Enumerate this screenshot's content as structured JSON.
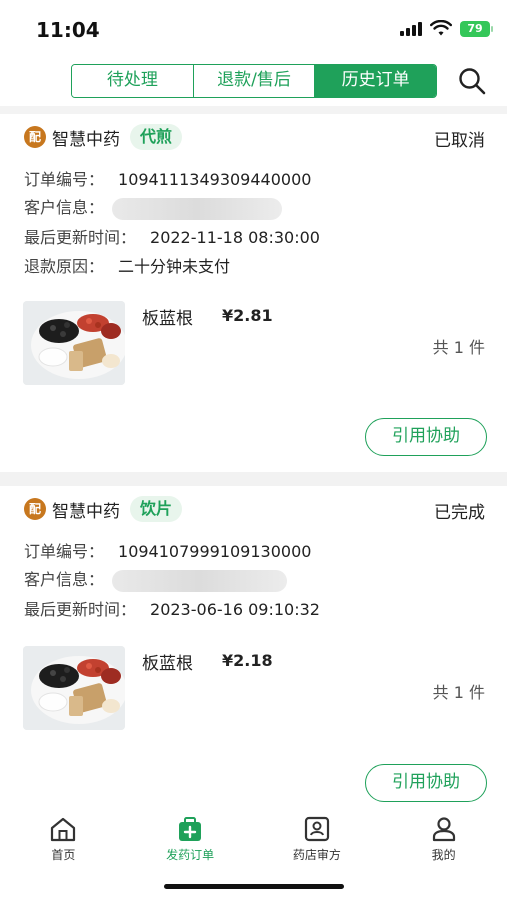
{
  "status_bar": {
    "time": "11:04",
    "battery": "79"
  },
  "tabs": [
    {
      "label": "待处理",
      "active": false
    },
    {
      "label": "退款/售后",
      "active": false
    },
    {
      "label": "历史订单",
      "active": true
    }
  ],
  "orders": [
    {
      "badge": "配",
      "shop": "智慧中药",
      "type_tag": "代煎",
      "status": "已取消",
      "order_no_label": "订单编号：",
      "order_no": "1094111349309440000",
      "customer_label": "客户信息：",
      "updated_label": "最后更新时间：",
      "updated": "2022-11-18 08:30:00",
      "refund_label": "退款原因：",
      "refund_reason": "二十分钟未支付",
      "product_name": "板蓝根",
      "price": "¥2.81",
      "qty": "共 1 件",
      "action": "引用协助"
    },
    {
      "badge": "配",
      "shop": "智慧中药",
      "type_tag": "饮片",
      "status": "已完成",
      "order_no_label": "订单编号：",
      "order_no": "1094107999109130000",
      "customer_label": "客户信息：",
      "updated_label": "最后更新时间：",
      "updated": "2023-06-16 09:10:32",
      "product_name": "板蓝根",
      "price": "¥2.18",
      "qty": "共 1 件",
      "action": "引用协助"
    }
  ],
  "nav": [
    {
      "label": "首页",
      "icon": "home-icon",
      "active": false
    },
    {
      "label": "发药订单",
      "icon": "medicine-bag-icon",
      "active": true
    },
    {
      "label": "药店审方",
      "icon": "prescription-review-icon",
      "active": false
    },
    {
      "label": "我的",
      "icon": "user-icon",
      "active": false
    }
  ],
  "colors": {
    "accent": "#1fa15a",
    "badge": "#c7771e",
    "tag_bg": "#e8f5ec"
  }
}
